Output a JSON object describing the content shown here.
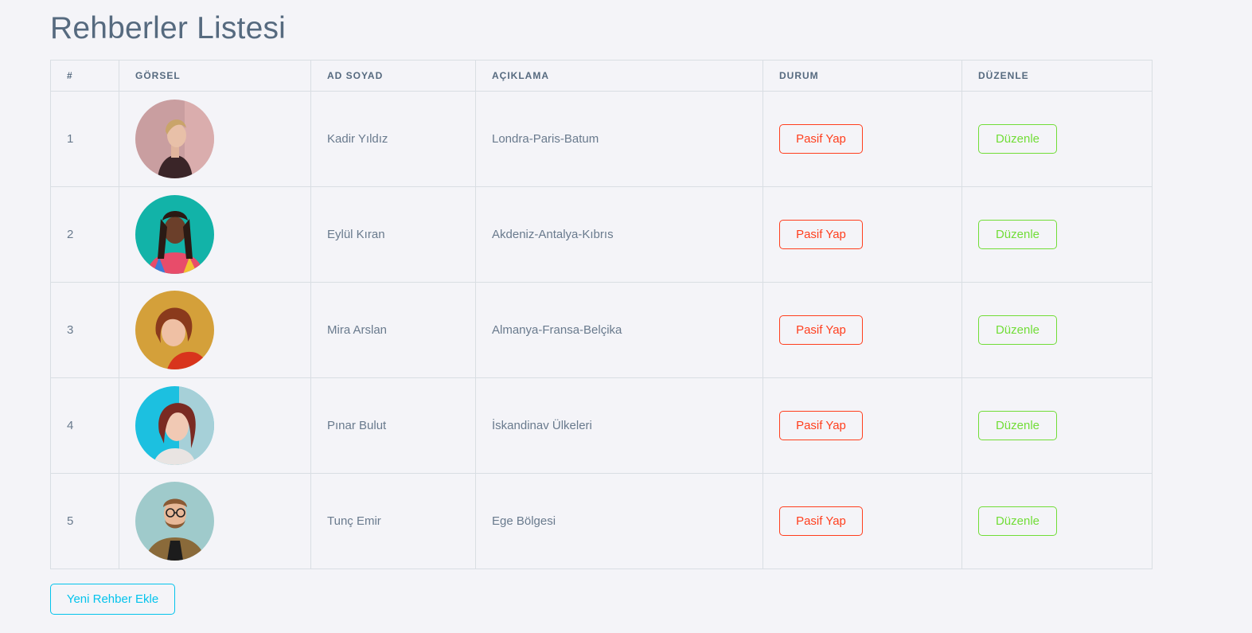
{
  "page": {
    "title": "Rehberler Listesi"
  },
  "table": {
    "headers": {
      "num": "#",
      "image": "GÖRSEL",
      "name": "AD SOYAD",
      "description": "AÇIKLAMA",
      "status": "DURUM",
      "edit": "DÜZENLE"
    },
    "rows": [
      {
        "num": "1",
        "name": "Kadir Yıldız",
        "description": "Londra-Paris-Batum",
        "status_button": "Pasif Yap",
        "edit_button": "Düzenle",
        "avatar_bg": "#c99ea0"
      },
      {
        "num": "2",
        "name": "Eylül Kıran",
        "description": "Akdeniz-Antalya-Kıbrıs",
        "status_button": "Pasif Yap",
        "edit_button": "Düzenle",
        "avatar_bg": "#12b3a8"
      },
      {
        "num": "3",
        "name": "Mira Arslan",
        "description": "Almanya-Fransa-Belçika",
        "status_button": "Pasif Yap",
        "edit_button": "Düzenle",
        "avatar_bg": "#d4a03a"
      },
      {
        "num": "4",
        "name": "Pınar Bulut",
        "description": "İskandinav Ülkeleri",
        "status_button": "Pasif Yap",
        "edit_button": "Düzenle",
        "avatar_bg": "#1cc0e0"
      },
      {
        "num": "5",
        "name": "Tunç Emir",
        "description": "Ege Bölgesi",
        "status_button": "Pasif Yap",
        "edit_button": "Düzenle",
        "avatar_bg": "#9fcacb"
      }
    ]
  },
  "add_button": {
    "label": "Yeni Rehber Ekle"
  },
  "colors": {
    "danger": "#ff3e1d",
    "success": "#71dd37",
    "info": "#03c3ec",
    "text": "#697a8d",
    "heading": "#566a7f"
  }
}
